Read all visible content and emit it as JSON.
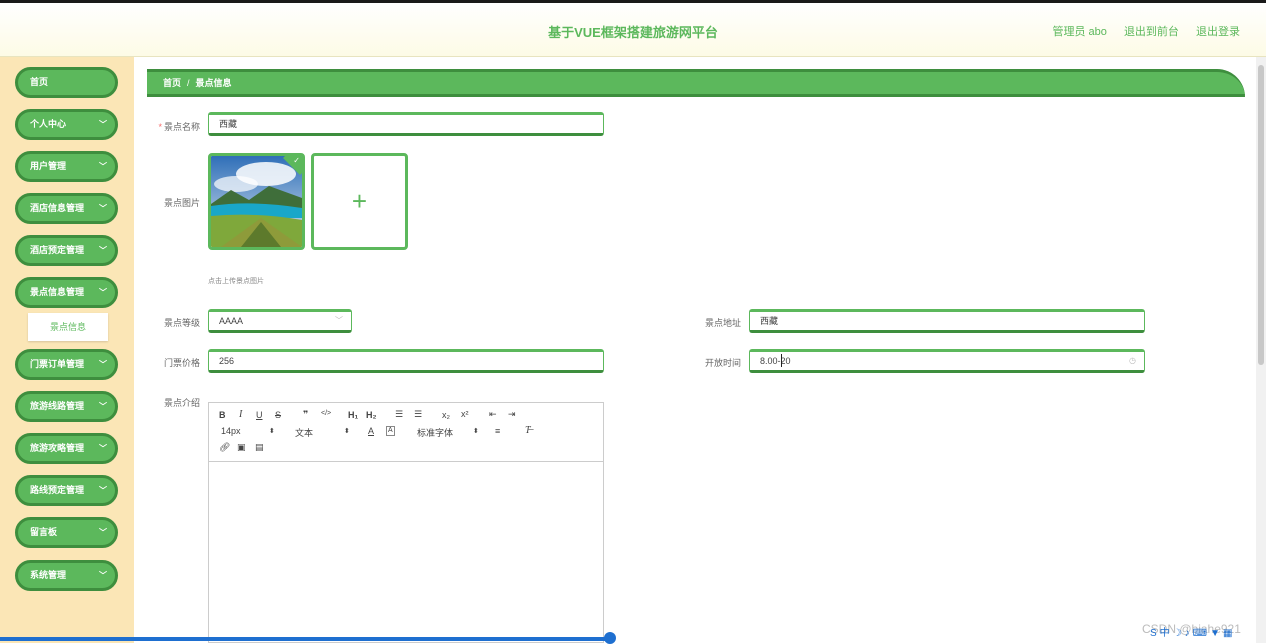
{
  "header": {
    "title": "基于VUE框架搭建旅游网平台",
    "user": "管理员 abo",
    "to_front": "退出到前台",
    "logout": "退出登录"
  },
  "sidebar": {
    "items": [
      {
        "label": "首页",
        "has_chevron": false
      },
      {
        "label": "个人中心",
        "has_chevron": true
      },
      {
        "label": "用户管理",
        "has_chevron": true
      },
      {
        "label": "酒店信息管理",
        "has_chevron": true
      },
      {
        "label": "酒店预定管理",
        "has_chevron": true
      },
      {
        "label": "景点信息管理",
        "has_chevron": true
      },
      {
        "label": "门票订单管理",
        "has_chevron": true
      },
      {
        "label": "旅游线路管理",
        "has_chevron": true
      },
      {
        "label": "旅游攻略管理",
        "has_chevron": true
      },
      {
        "label": "路线预定管理",
        "has_chevron": true
      },
      {
        "label": "留言板",
        "has_chevron": true
      },
      {
        "label": "系统管理",
        "has_chevron": true
      }
    ],
    "submenu": {
      "label": "景点信息"
    }
  },
  "breadcrumb": {
    "home": "首页",
    "separator": "/",
    "current": "景点信息"
  },
  "form": {
    "name_label": "景点名称",
    "name_value": "西藏",
    "image_label": "景点图片",
    "image_hint": "点击上传景点图片",
    "level_label": "景点等级",
    "level_value": "AAAA",
    "address_label": "景点地址",
    "address_value": "西藏",
    "price_label": "门票价格",
    "price_value": "256",
    "open_label": "开放时间",
    "open_value": "8.00-20",
    "intro_label": "景点介绍"
  },
  "editor": {
    "font_size": "14px",
    "block_type": "文本",
    "font_family": "标准字体"
  },
  "colors": {
    "accent": "#5cb85c",
    "accent_dark": "#3e8e3e",
    "sidebar_bg": "#fbe6b6"
  },
  "watermark": "CSDN @biahe921"
}
